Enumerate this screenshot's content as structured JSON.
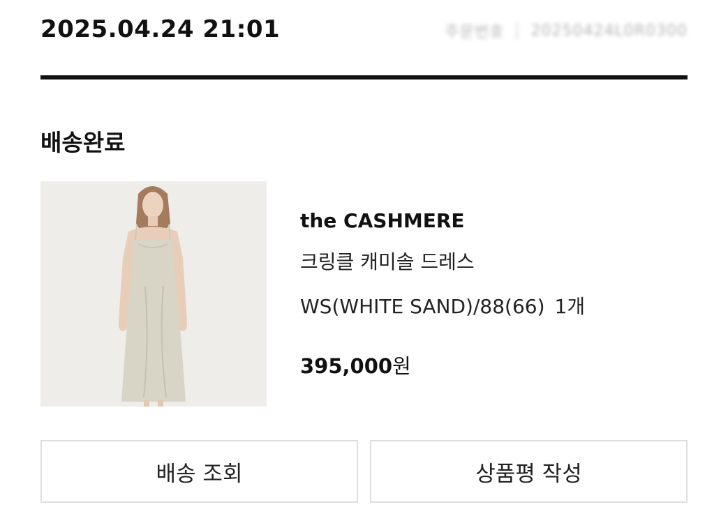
{
  "order": {
    "date": "2025.04.24 21:01",
    "number_label": "주문번호",
    "number_value": "20250424L0R0300"
  },
  "status": {
    "label": "배송완료"
  },
  "product": {
    "image_icon": "product-photo",
    "brand": "the CASHMERE",
    "name": "크링클 캐미솔 드레스",
    "option": "WS(WHITE SAND)/88(66)",
    "quantity": "1개",
    "price_amount": "395,000",
    "price_unit": "원"
  },
  "actions": {
    "track_label": "배송 조회",
    "review_label": "상품평 작성"
  },
  "colors": {
    "text": "#111111",
    "divider": "#111111",
    "button_border": "#dedede",
    "image_background": "#efede9",
    "dress": "#d9d5c6"
  }
}
